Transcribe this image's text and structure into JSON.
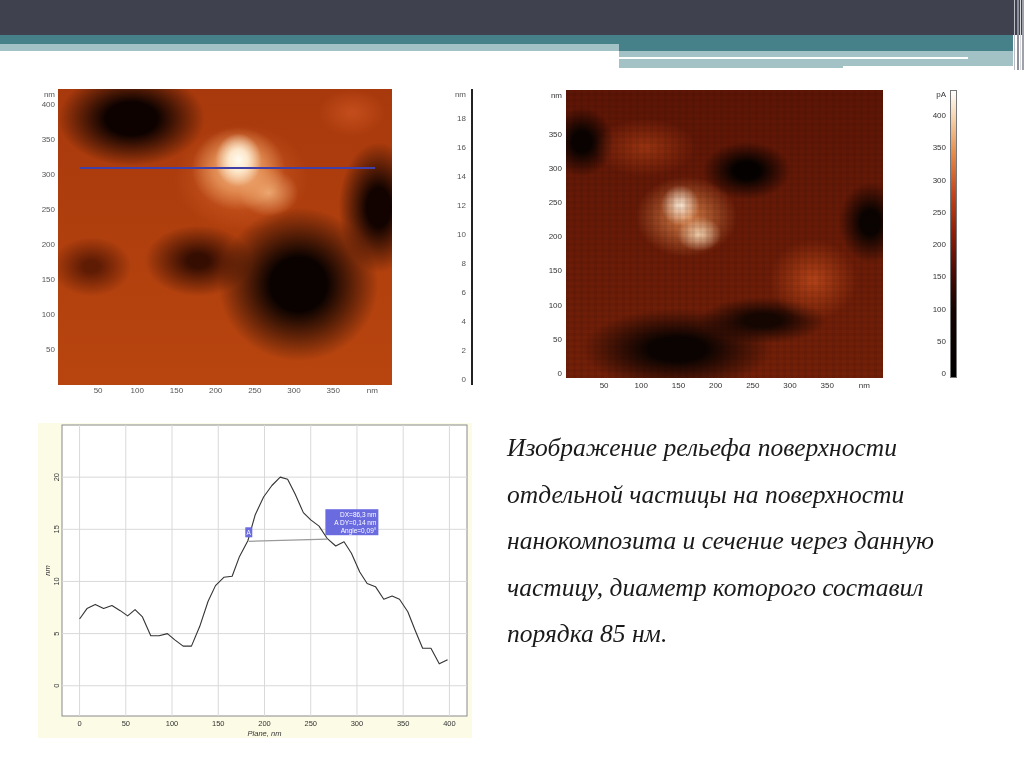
{
  "height_map": {
    "y_unit": "nm",
    "y_ticks": [
      "400",
      "350",
      "300",
      "250",
      "200",
      "150",
      "100",
      "50"
    ],
    "x_ticks": [
      "50",
      "100",
      "150",
      "200",
      "250",
      "300",
      "350"
    ],
    "x_unit": "nm",
    "scale": {
      "unit": "nm",
      "ticks": [
        "18",
        "16",
        "14",
        "12",
        "10",
        "8",
        "6",
        "4",
        "2",
        "0"
      ]
    }
  },
  "current_map": {
    "y_unit": "nm",
    "y_ticks": [
      "350",
      "300",
      "250",
      "200",
      "150",
      "100",
      "50",
      "0"
    ],
    "x_ticks": [
      "50",
      "100",
      "150",
      "200",
      "250",
      "300",
      "350"
    ],
    "x_unit": "nm",
    "scale": {
      "unit": "pA",
      "ticks": [
        "400",
        "350",
        "300",
        "250",
        "200",
        "150",
        "100",
        "50",
        "0"
      ]
    }
  },
  "profile": {
    "chart_data": {
      "type": "line",
      "xlabel": "Plane, nm",
      "ylabel": "nm",
      "x": [
        0,
        8,
        17,
        26,
        35,
        44,
        52,
        60,
        68,
        77,
        86,
        95,
        103,
        112,
        121,
        130,
        139,
        147,
        156,
        165,
        173,
        182,
        190,
        199,
        208,
        217,
        225,
        233,
        242,
        250,
        259,
        268,
        277,
        286,
        294,
        303,
        311,
        320,
        329,
        338,
        346,
        355,
        363,
        371,
        380,
        389,
        398
      ],
      "series": [
        {
          "color": "#333333",
          "values": [
            6.4,
            7.4,
            7.8,
            7.4,
            7.7,
            7.2,
            6.7,
            7.3,
            6.6,
            4.8,
            4.8,
            5.0,
            4.4,
            3.8,
            3.8,
            5.7,
            8.1,
            9.6,
            10.4,
            10.5,
            12.4,
            13.9,
            16.4,
            18.1,
            19.2,
            20.0,
            19.8,
            18.4,
            16.6,
            15.9,
            15.3,
            14.1,
            13.4,
            13.8,
            12.7,
            10.9,
            9.8,
            9.5,
            8.3,
            8.6,
            8.3,
            7.1,
            5.3,
            3.6,
            3.6,
            2.1,
            2.5
          ]
        }
      ],
      "xlim": [
        -19,
        419
      ],
      "ylim": [
        -2.9,
        25
      ],
      "xticks": [
        0,
        50,
        100,
        150,
        200,
        250,
        300,
        350,
        400
      ],
      "yticks": [
        0,
        5,
        10,
        15,
        20
      ],
      "grid": true,
      "annotations": [
        {
          "text": "A",
          "x": 183,
          "y": 13.85
        },
        {
          "text": "DX=86,3 nm\nA DY=0,14 nm\nAngle=0,09°",
          "x": 268,
          "y": 14.05
        }
      ]
    }
  },
  "caption": "Изображение рельефа поверхности отдельной частицы на поверхности нанокомпозита и сечение через данную частицу, диаметр которого составил порядка 85 нм."
}
